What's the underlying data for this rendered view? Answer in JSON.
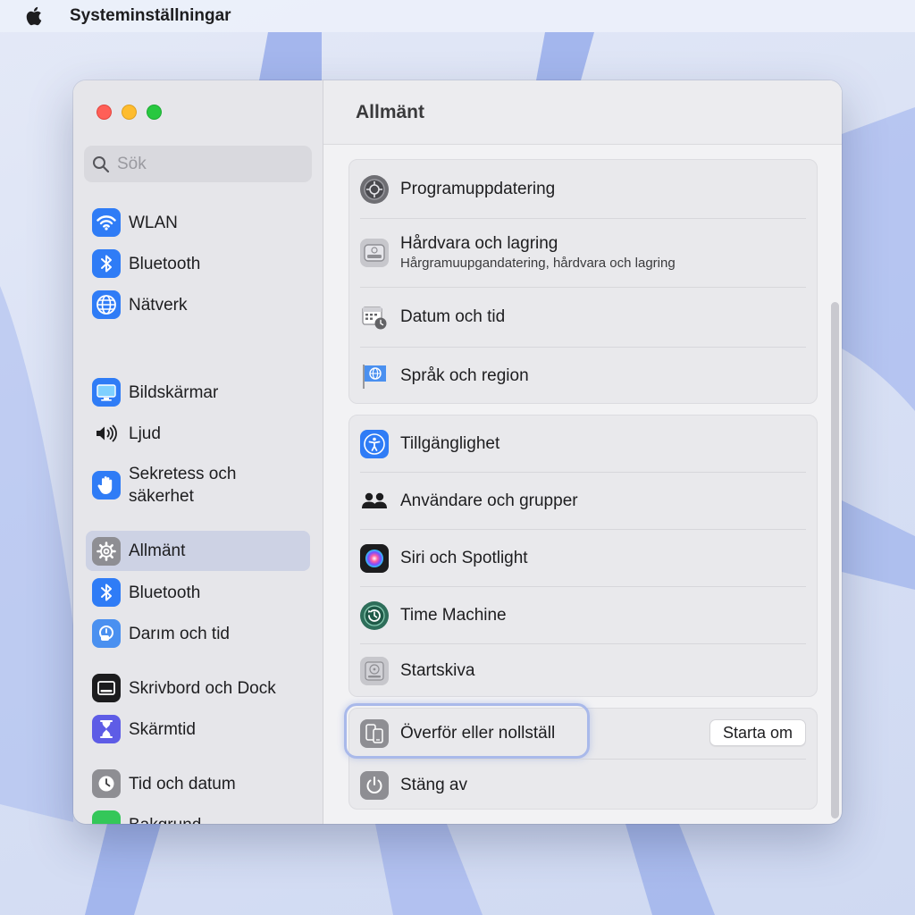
{
  "menubar": {
    "app_title": "Systeminställningar"
  },
  "search": {
    "placeholder": "Sök"
  },
  "sidebar": {
    "items": [
      {
        "label": "WLAN",
        "icon": "wifi-icon"
      },
      {
        "label": "Bluetooth",
        "icon": "bluetooth-icon"
      },
      {
        "label": "Nätverk",
        "icon": "globe-icon"
      },
      {
        "label": "Bildskärmar",
        "icon": "display-icon"
      },
      {
        "label": "Ljud",
        "icon": "speaker-icon"
      },
      {
        "label": "Sekretess och\nsäkerhet",
        "icon": "hand-icon"
      },
      {
        "label": "Allmänt",
        "icon": "gear-icon",
        "selected": true
      },
      {
        "label": "Bluetooth",
        "icon": "bluetooth-icon"
      },
      {
        "label": "Darım och tid",
        "icon": "datetime-icon"
      },
      {
        "label": "Skrivbord och Dock",
        "icon": "dock-icon"
      },
      {
        "label": "Skärmtid",
        "icon": "hourglass-icon"
      },
      {
        "label": "Tid och datum",
        "icon": "clock-icon"
      },
      {
        "label": "Bakgrund",
        "icon": "wallpaper-icon"
      }
    ]
  },
  "main": {
    "title": "Allmänt",
    "group1": [
      {
        "title": "Programuppdatering",
        "icon": "software-update-icon"
      },
      {
        "title": "Hårdvara och lagring",
        "subtitle": "Hårgramuupgandatering, hårdvara och lagring",
        "icon": "storage-icon"
      },
      {
        "title": "Datum och tid",
        "icon": "calendar-clock-icon"
      },
      {
        "title": "Språk och region",
        "icon": "flag-globe-icon"
      }
    ],
    "group2": [
      {
        "title": "Tillgänglighet",
        "icon": "accessibility-icon"
      },
      {
        "title": "Användare och grupper",
        "icon": "users-icon"
      },
      {
        "title": "Siri och Spotlight",
        "icon": "siri-icon"
      },
      {
        "title": "Time Machine",
        "icon": "time-machine-icon"
      },
      {
        "title": "Startskiva",
        "icon": "disk-icon"
      }
    ],
    "group3": [
      {
        "title": "Överför eller nollställ",
        "icon": "transfer-reset-icon",
        "highlighted": true
      },
      {
        "title": "Stäng av",
        "icon": "power-icon"
      }
    ],
    "restart_label": "Starta om"
  },
  "colors": {
    "accent_blue": "#2f7cf6",
    "selected_bg": "#cdd2e4",
    "highlight_ring": "#a9b9ea"
  }
}
